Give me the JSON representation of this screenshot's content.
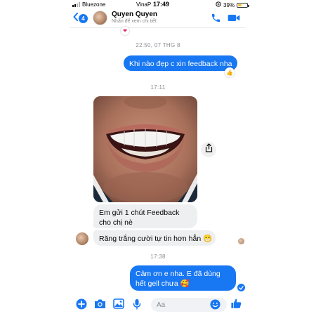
{
  "status_bar": {
    "carrier_left": "Bluezone",
    "carrier_center": "VinaP",
    "time": "17:49",
    "battery": "39%",
    "battery_level": 0.39
  },
  "header": {
    "back_count": "4",
    "contact_name": "Quyen Quyen",
    "subtitle": "Nhấn để xem chi tiết"
  },
  "messages": {
    "ts_1": "22:50, 07 THG 8",
    "msg_1": "Khi nào đẹp c xin feedback nha",
    "ts_2": "17:11",
    "msg_2": "Em gửi 1 chút Feedback cho chị nè",
    "msg_3": "Răng trắng cười tự tin hơn hẳn 😁",
    "ts_3": "17:38",
    "msg_4": "Cảm ơn e nha. E đã dùng hết gell chưa 🥰"
  },
  "reactions": {
    "heart": "❤",
    "thumb": "👍"
  },
  "composer": {
    "placeholder": "Aa"
  },
  "colors": {
    "accent": "#1877f2",
    "incoming_bubble": "#eeeff1"
  }
}
